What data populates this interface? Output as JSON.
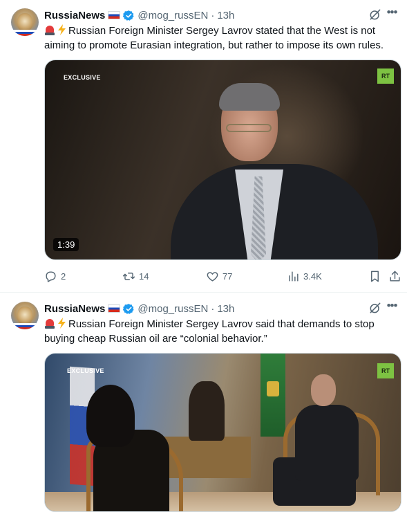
{
  "tweets": [
    {
      "author": {
        "name": "RussiaNews",
        "handle": "@mog_russEN",
        "time": "13h",
        "avatar": "lion-avatar"
      },
      "text": "Russian Foreign Minister Sergey Lavrov stated that the West is not aiming to promote Eurasian integration, but rather to impose its own rules.",
      "video": {
        "badge": "EXCLUSIVE",
        "logo": "RT",
        "duration": "1:39"
      },
      "actions": {
        "replies": "2",
        "reposts": "14",
        "likes": "77",
        "views": "3.4K"
      }
    },
    {
      "author": {
        "name": "RussiaNews",
        "handle": "@mog_russEN",
        "time": "13h",
        "avatar": "lion-avatar"
      },
      "text": "Russian Foreign Minister Sergey Lavrov said that demands to stop buying cheap Russian oil are “colonial behavior.”",
      "video": {
        "badge": "EXCLUSIVE",
        "logo": "RT"
      }
    }
  ],
  "icons": [
    "grok-icon",
    "more-icon",
    "reply-icon",
    "repost-icon",
    "like-icon",
    "views-icon",
    "bookmark-icon",
    "share-icon",
    "verified-badge-icon",
    "russia-flag-icon",
    "siren-emoji",
    "lightning-emoji"
  ],
  "colors": {
    "text": "#0f1419",
    "secondary": "#536471",
    "verified": "#1d9bf0",
    "rt_green": "#7dc242",
    "divider": "#eff3f4"
  }
}
